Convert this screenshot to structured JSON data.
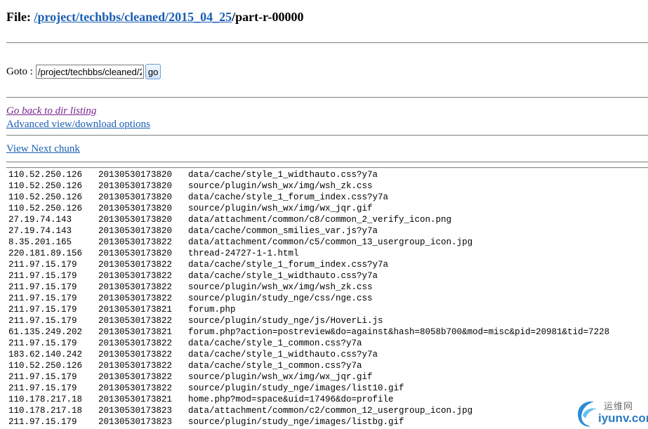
{
  "header": {
    "file_label": "File:",
    "path_segments": [
      "/project",
      "/techbbs",
      "/cleaned",
      "/2015_04_25",
      "/part-r-00000"
    ]
  },
  "goto": {
    "label": "Goto :",
    "input_value": "/project/techbbs/cleaned/2",
    "button_label": "go"
  },
  "links": {
    "back": "Go back to dir listing",
    "advanced": "Advanced view/download options",
    "next_chunk": "View Next chunk"
  },
  "rows": [
    {
      "ip": "110.52.250.126",
      "ts": "20130530173820",
      "path": "data/cache/style_1_widthauto.css?y7a"
    },
    {
      "ip": "110.52.250.126",
      "ts": "20130530173820",
      "path": "source/plugin/wsh_wx/img/wsh_zk.css"
    },
    {
      "ip": "110.52.250.126",
      "ts": "20130530173820",
      "path": "data/cache/style_1_forum_index.css?y7a"
    },
    {
      "ip": "110.52.250.126",
      "ts": "20130530173820",
      "path": "source/plugin/wsh_wx/img/wx_jqr.gif"
    },
    {
      "ip": "27.19.74.143",
      "ts": "20130530173820",
      "path": "data/attachment/common/c8/common_2_verify_icon.png"
    },
    {
      "ip": "27.19.74.143",
      "ts": "20130530173820",
      "path": "data/cache/common_smilies_var.js?y7a"
    },
    {
      "ip": "8.35.201.165",
      "ts": "20130530173822",
      "path": "data/attachment/common/c5/common_13_usergroup_icon.jpg"
    },
    {
      "ip": "220.181.89.156",
      "ts": "20130530173820",
      "path": "thread-24727-1-1.html"
    },
    {
      "ip": "211.97.15.179",
      "ts": "20130530173822",
      "path": "data/cache/style_1_forum_index.css?y7a"
    },
    {
      "ip": "211.97.15.179",
      "ts": "20130530173822",
      "path": "data/cache/style_1_widthauto.css?y7a"
    },
    {
      "ip": "211.97.15.179",
      "ts": "20130530173822",
      "path": "source/plugin/wsh_wx/img/wsh_zk.css"
    },
    {
      "ip": "211.97.15.179",
      "ts": "20130530173822",
      "path": "source/plugin/study_nge/css/nge.css"
    },
    {
      "ip": "211.97.15.179",
      "ts": "20130530173821",
      "path": "forum.php"
    },
    {
      "ip": "211.97.15.179",
      "ts": "20130530173822",
      "path": "source/plugin/study_nge/js/HoverLi.js"
    },
    {
      "ip": "61.135.249.202",
      "ts": "20130530173821",
      "path": "forum.php?action=postreview&do=against&hash=8058b700&mod=misc&pid=20981&tid=7228"
    },
    {
      "ip": "211.97.15.179",
      "ts": "20130530173822",
      "path": "data/cache/style_1_common.css?y7a"
    },
    {
      "ip": "183.62.140.242",
      "ts": "20130530173822",
      "path": "data/cache/style_1_widthauto.css?y7a"
    },
    {
      "ip": "110.52.250.126",
      "ts": "20130530173822",
      "path": "data/cache/style_1_common.css?y7a"
    },
    {
      "ip": "211.97.15.179",
      "ts": "20130530173822",
      "path": "source/plugin/wsh_wx/img/wx_jqr.gif"
    },
    {
      "ip": "211.97.15.179",
      "ts": "20130530173822",
      "path": "source/plugin/study_nge/images/list10.gif"
    },
    {
      "ip": "110.178.217.18",
      "ts": "20130530173821",
      "path": "home.php?mod=space&uid=17496&do=profile"
    },
    {
      "ip": "110.178.217.18",
      "ts": "20130530173823",
      "path": "data/attachment/common/c2/common_12_usergroup_icon.jpg"
    },
    {
      "ip": "211.97.15.179",
      "ts": "20130530173823",
      "path": "source/plugin/study_nge/images/listbg.gif"
    }
  ],
  "watermark": {
    "site_cn": "运维网",
    "site_en": "iyunv.com"
  },
  "colors": {
    "link": "#1a5fb4",
    "visited_link": "#7a1f8f",
    "rule": "#8f8f8f"
  }
}
